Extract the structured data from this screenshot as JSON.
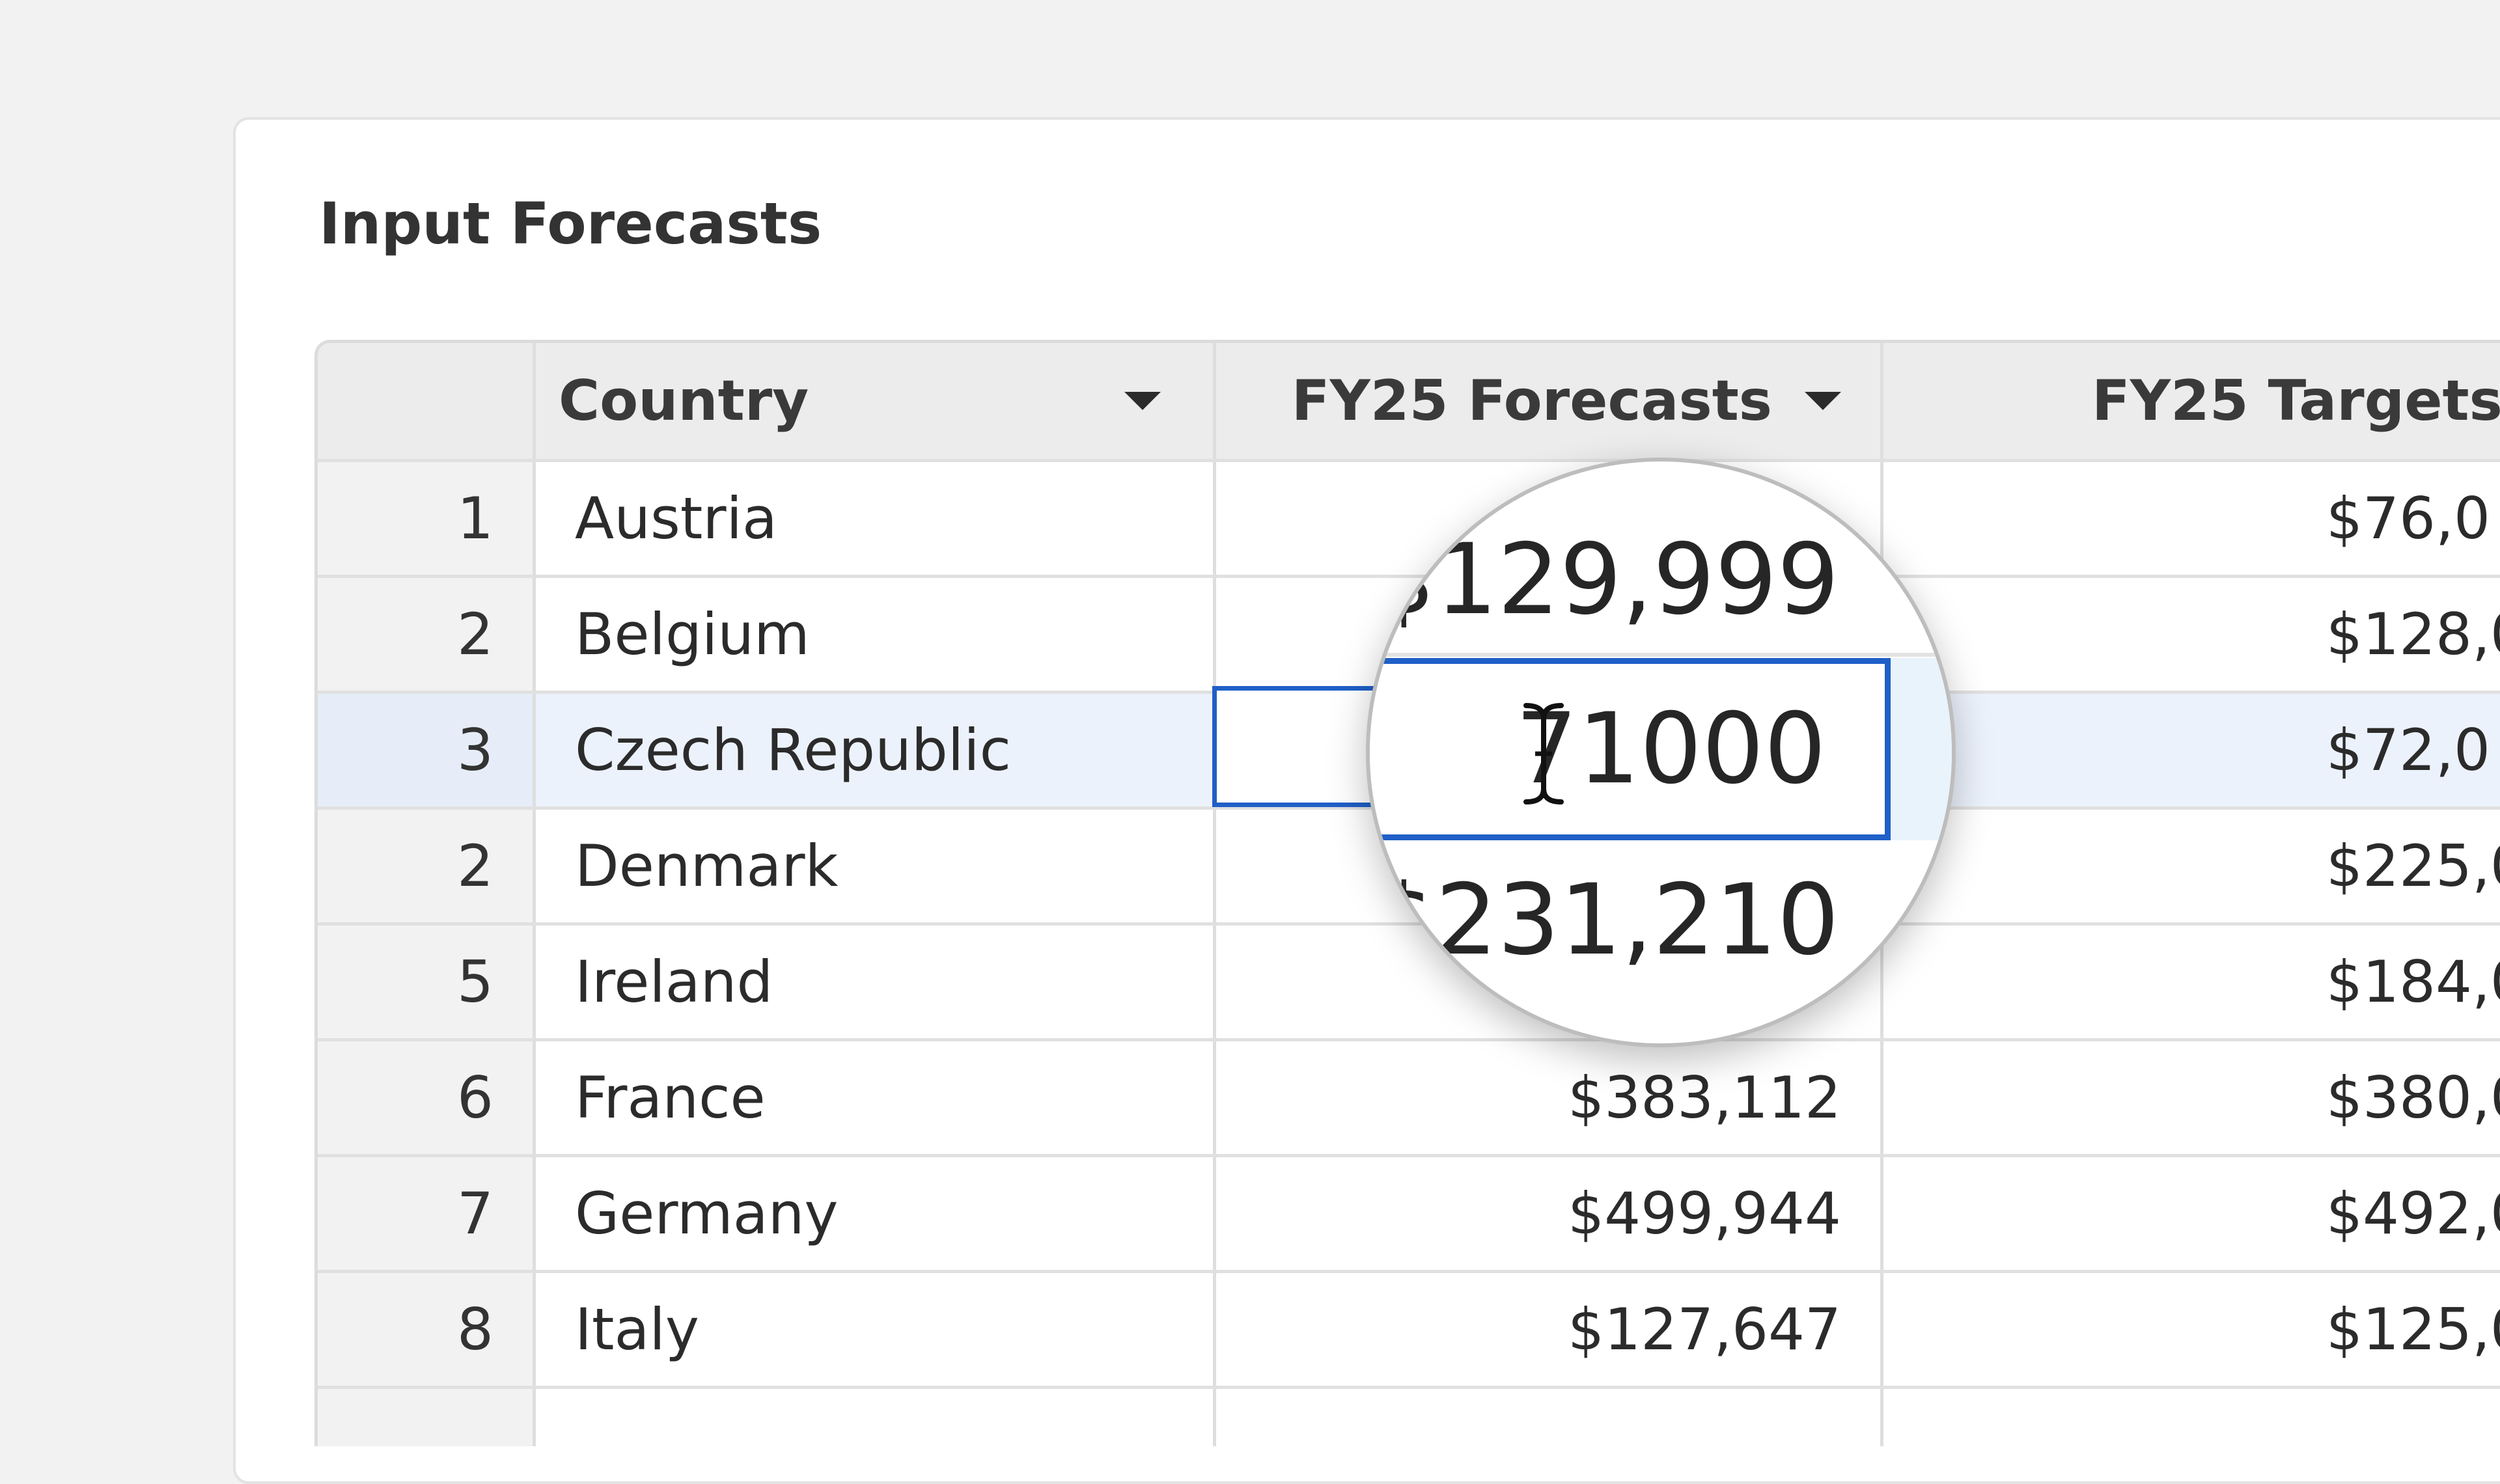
{
  "panel": {
    "title": "Input Forecasts"
  },
  "table": {
    "columns": {
      "country": "Country",
      "forecasts": "FY25 Forecasts",
      "targets": "FY25 Targets"
    },
    "rows": [
      {
        "num": "1",
        "country": "Austria",
        "forecast": "",
        "target": "$76,0"
      },
      {
        "num": "2",
        "country": "Belgium",
        "forecast": "",
        "target": "$128,0"
      },
      {
        "num": "3",
        "country": "Czech Republic",
        "forecast": "",
        "target": "$72,0"
      },
      {
        "num": "2",
        "country": "Denmark",
        "forecast": "",
        "target": "$225,0"
      },
      {
        "num": "5",
        "country": "Ireland",
        "forecast": "",
        "target": "$184,0"
      },
      {
        "num": "6",
        "country": "France",
        "forecast": "$383,112",
        "target": "$380,0"
      },
      {
        "num": "7",
        "country": "Germany",
        "forecast": "$499,944",
        "target": "$492,0"
      },
      {
        "num": "8",
        "country": "Italy",
        "forecast": "$127,647",
        "target": "$125,0"
      }
    ]
  },
  "magnifier": {
    "above_value": "$129,999",
    "editing_value": "71000",
    "below_value": "$231,210"
  },
  "colors": {
    "accent": "#1f5fc7",
    "selected_row": "#ecf2fc"
  },
  "icons": {
    "dropdown": "caret-down-icon",
    "cursor": "text-cursor-icon"
  }
}
